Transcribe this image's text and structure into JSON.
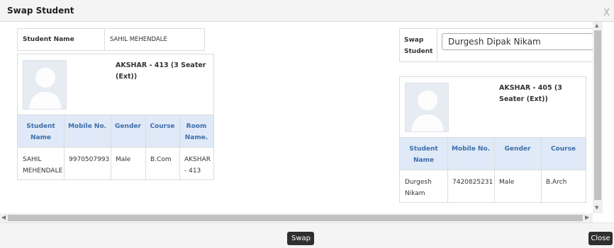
{
  "dialog": {
    "title": "Swap Student",
    "close_glyph": "X"
  },
  "student_name": {
    "label": "Student Name",
    "value": "SAHIL MEHENDALE"
  },
  "left_room": {
    "room_title_line1": "AKSHAR - 413 (3 Seater",
    "room_title_line2": "(Ext))",
    "columns": [
      {
        "line1": "Student",
        "line2": "Name"
      },
      {
        "line1": "Mobile No.",
        "line2": ""
      },
      {
        "line1": "Gender",
        "line2": ""
      },
      {
        "line1": "Course",
        "line2": ""
      },
      {
        "line1": "Room",
        "line2": "Name."
      }
    ],
    "row": {
      "name_line1": "SAHIL",
      "name_line2": "MEHENDALE",
      "mobile": "9970507993",
      "gender": "Male",
      "course": "B.Com",
      "room_line1": "AKSHAR",
      "room_line2": "- 413"
    }
  },
  "swap_student": {
    "label_line1": "Swap",
    "label_line2": "Student",
    "selected": "Durgesh Dipak Nikam"
  },
  "right_room": {
    "room_title_line1": "AKSHAR - 405 (3",
    "room_title_line2": "Seater (Ext))",
    "columns": [
      {
        "line1": "Student",
        "line2": "Name"
      },
      {
        "line1": "Mobile No.",
        "line2": ""
      },
      {
        "line1": "Gender",
        "line2": ""
      },
      {
        "line1": "Course",
        "line2": ""
      }
    ],
    "row": {
      "name_line1": "Durgesh",
      "name_line2": "Nikam",
      "mobile": "7420825231",
      "gender": "Male",
      "course": "B.Arch"
    }
  },
  "footer": {
    "swap_label": "Swap",
    "close_label": "Close"
  },
  "icons": {
    "user_avatar": "user-silhouette-icon",
    "window_close": "close-icon"
  },
  "colors": {
    "table_header_bg": "#dfe9f8",
    "table_header_text": "#3e6ea8",
    "button_bg": "#2f2f2f"
  }
}
